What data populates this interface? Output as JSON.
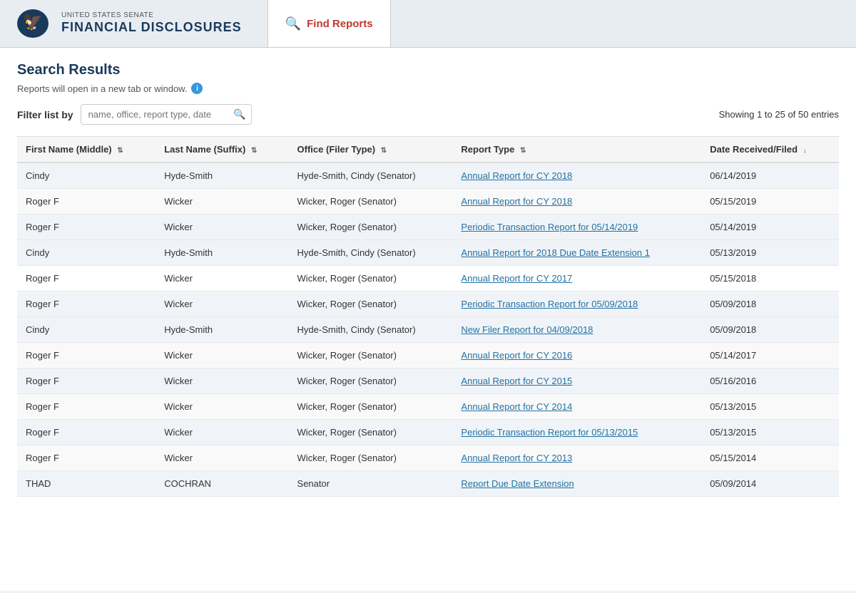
{
  "header": {
    "logo_top": "UNITED STATES SENATE",
    "logo_bottom": "FINANCIAL DISCLOSURES",
    "nav_tab_label": "Find Reports",
    "nav_tab_icon": "🔍"
  },
  "search": {
    "title": "Search Results",
    "notice": "Reports will open in a new tab or window.",
    "filter_label": "Filter list by",
    "filter_placeholder": "name, office, report type, date",
    "showing_text": "Showing 1 to 25 of 50 entries"
  },
  "table": {
    "columns": [
      {
        "label": "First Name (Middle)",
        "sort": "both"
      },
      {
        "label": "Last Name (Suffix)",
        "sort": "both"
      },
      {
        "label": "Office (Filer Type)",
        "sort": "both"
      },
      {
        "label": "Report Type",
        "sort": "both"
      },
      {
        "label": "Date Received/Filed",
        "sort": "down"
      }
    ],
    "rows": [
      {
        "first": "Cindy",
        "last": "Hyde-Smith",
        "office": "Hyde-Smith, Cindy (Senator)",
        "report": "Annual Report for CY 2018",
        "date": "06/14/2019",
        "shaded": true
      },
      {
        "first": "Roger F",
        "last": "Wicker",
        "office": "Wicker, Roger (Senator)",
        "report": "Annual Report for CY 2018",
        "date": "05/15/2019",
        "shaded": false
      },
      {
        "first": "Roger F",
        "last": "Wicker",
        "office": "Wicker, Roger (Senator)",
        "report": "Periodic Transaction Report for 05/14/2019",
        "date": "05/14/2019",
        "shaded": true
      },
      {
        "first": "Cindy",
        "last": "Hyde-Smith",
        "office": "Hyde-Smith, Cindy (Senator)",
        "report": "Annual Report for 2018 Due Date Extension 1",
        "date": "05/13/2019",
        "shaded": true
      },
      {
        "first": "Roger F",
        "last": "Wicker",
        "office": "Wicker, Roger (Senator)",
        "report": "Annual Report for CY 2017",
        "date": "05/15/2018",
        "shaded": false
      },
      {
        "first": "Roger F",
        "last": "Wicker",
        "office": "Wicker, Roger (Senator)",
        "report": "Periodic Transaction Report for 05/09/2018",
        "date": "05/09/2018",
        "shaded": true
      },
      {
        "first": "Cindy",
        "last": "Hyde-Smith",
        "office": "Hyde-Smith, Cindy (Senator)",
        "report": "New Filer Report for 04/09/2018",
        "date": "05/09/2018",
        "shaded": true
      },
      {
        "first": "Roger F",
        "last": "Wicker",
        "office": "Wicker, Roger (Senator)",
        "report": "Annual Report for CY 2016",
        "date": "05/14/2017",
        "shaded": false
      },
      {
        "first": "Roger F",
        "last": "Wicker",
        "office": "Wicker, Roger (Senator)",
        "report": "Annual Report for CY 2015",
        "date": "05/16/2016",
        "shaded": true
      },
      {
        "first": "Roger F",
        "last": "Wicker",
        "office": "Wicker, Roger (Senator)",
        "report": "Annual Report for CY 2014",
        "date": "05/13/2015",
        "shaded": false
      },
      {
        "first": "Roger F",
        "last": "Wicker",
        "office": "Wicker, Roger (Senator)",
        "report": "Periodic Transaction Report for 05/13/2015",
        "date": "05/13/2015",
        "shaded": true
      },
      {
        "first": "Roger F",
        "last": "Wicker",
        "office": "Wicker, Roger (Senator)",
        "report": "Annual Report for CY 2013",
        "date": "05/15/2014",
        "shaded": false
      },
      {
        "first": "THAD",
        "last": "COCHRAN",
        "office": "Senator",
        "report": "Report Due Date Extension",
        "date": "05/09/2014",
        "shaded": true
      }
    ]
  }
}
